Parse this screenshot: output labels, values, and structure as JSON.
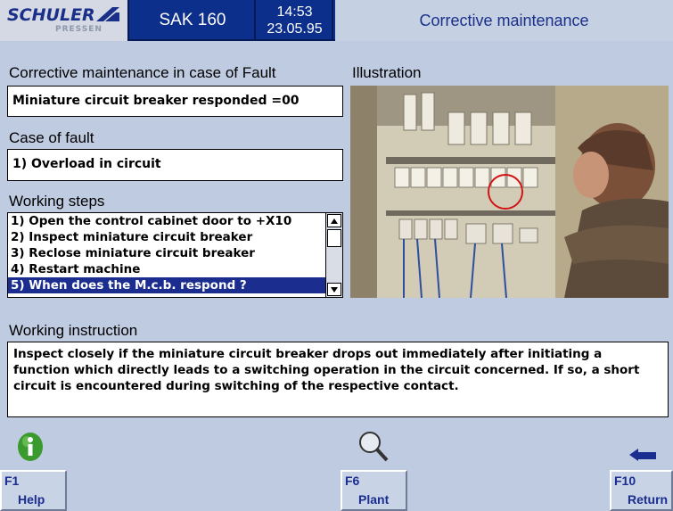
{
  "header": {
    "logo_brand": "SCHULER",
    "logo_sub": "PRESSEN",
    "system": "SAK 160",
    "time": "14:53",
    "date": "23.05.95",
    "title": "Corrective maintenance"
  },
  "main": {
    "fault_heading": "Corrective maintenance in case of Fault",
    "fault_value": "Miniature circuit breaker responded =00",
    "case_heading": "Case of fault",
    "case_value": "1) Overload in circuit",
    "steps_heading": "Working steps",
    "steps": [
      "1) Open the control cabinet door to +X10",
      "2) Inspect miniature circuit breaker",
      "3) Reclose miniature circuit breaker",
      "4) Restart machine",
      "5) When does the M.c.b. respond ?"
    ],
    "selected_step_index": 4,
    "illustration_heading": "Illustration",
    "instruction_heading": "Working instruction",
    "instruction_text": "Inspect closely if the miniature circuit breaker drops out immediately after initiating a function which directly leads to a switching operation in the circuit concerned. If so, a short circuit is encountered during switching of the respective contact."
  },
  "icons": {
    "info": "info-icon",
    "magnifier": "magnifier-icon",
    "return": "return-arrow-icon"
  },
  "function_keys": [
    {
      "key": "F1",
      "label": "Help"
    },
    {
      "key": "F6",
      "label": "Plant"
    },
    {
      "key": "F10",
      "label": "Return"
    }
  ],
  "colors": {
    "header_bg": "#0d2f8c",
    "screen_bg": "#bfcbe0",
    "selection": "#1b2d8f",
    "info_green": "#3a9a2e"
  }
}
